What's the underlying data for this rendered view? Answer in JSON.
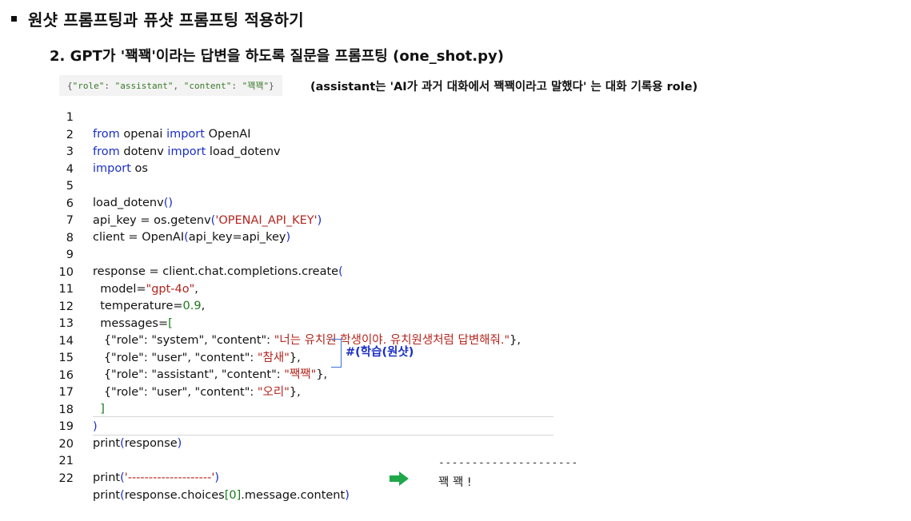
{
  "title": "원샷 프롬프팅과 퓨샷 프롬프팅 적용하기",
  "subtitle": "2. GPT가 '꽥꽥'이라는 답변을 하도록 질문을 프롬프팅 (one_shot.py)",
  "snippet": {
    "open": "{",
    "role_key": "\"role\"",
    "role_val": "\"assistant\"",
    "content_key": "\"content\"",
    "content_val": "\"꽥꽥\"",
    "close": "}"
  },
  "note": "(assistant는 'AI가 과거 대화에서 꽥꽥이라고 말했다' 는 대화 기록용 role)",
  "code_lines": [
    {
      "n": "1"
    },
    {
      "n": "2"
    },
    {
      "n": "3"
    },
    {
      "n": "4"
    },
    {
      "n": "5"
    },
    {
      "n": "6"
    },
    {
      "n": "7"
    },
    {
      "n": "8"
    },
    {
      "n": "9"
    },
    {
      "n": "10"
    },
    {
      "n": "11"
    },
    {
      "n": "12"
    },
    {
      "n": "13"
    },
    {
      "n": "14"
    },
    {
      "n": "15"
    },
    {
      "n": "16"
    },
    {
      "n": "17"
    },
    {
      "n": "18"
    },
    {
      "n": "19"
    },
    {
      "n": "20"
    },
    {
      "n": "21"
    },
    {
      "n": "22"
    }
  ],
  "code": {
    "l1": [
      "from",
      " openai ",
      "import",
      " OpenAI"
    ],
    "l2": [
      "from",
      " dotenv ",
      "import",
      " load_dotenv"
    ],
    "l3": [
      "import",
      " os"
    ],
    "l5": [
      "load_dotenv",
      "()"
    ],
    "l6": [
      "api_key = os.getenv",
      "(",
      "'OPENAI_API_KEY'",
      ")"
    ],
    "l7": [
      "client = OpenAI",
      "(",
      "api_key=api_key",
      ")"
    ],
    "l9": [
      "response = client.chat.completions.create",
      "("
    ],
    "l10": [
      "  model=",
      "\"gpt-4o\"",
      ","
    ],
    "l11": [
      "  temperature=",
      "0.9",
      ","
    ],
    "l12": [
      "  messages=",
      "["
    ],
    "l13": [
      "   {\"role\": \"system\", \"content\": ",
      "\"너는 유치원 학생이야. 유치원생처럼 답변해줘.\"",
      "},"
    ],
    "l14": [
      "   {\"role\": \"user\", \"content\": ",
      "\"참새\"",
      "},"
    ],
    "l15": [
      "   {\"role\": \"assistant\", \"content\": ",
      "\"짹짹\"",
      "},"
    ],
    "l16": [
      "   {\"role\": \"user\", \"content\": ",
      "\"오리\"",
      "},"
    ],
    "l17": [
      "  ]"
    ],
    "l18": [
      ")"
    ],
    "l19": [
      "print",
      "(",
      "response",
      ")"
    ],
    "l21": [
      "print",
      "(",
      "'--------------------'",
      ")"
    ],
    "l22": [
      "print",
      "(",
      "response.choices",
      "[0]",
      ".message.content",
      ")"
    ]
  },
  "annotation": "#(학습(원샷)",
  "output": {
    "dashes": "---------------------",
    "result": "꽥 꽥 !"
  },
  "colors": {
    "keyword": "#1b2fc7",
    "string": "#b3261e",
    "number": "#1a7a1a",
    "arrow": "#1fa84a"
  }
}
